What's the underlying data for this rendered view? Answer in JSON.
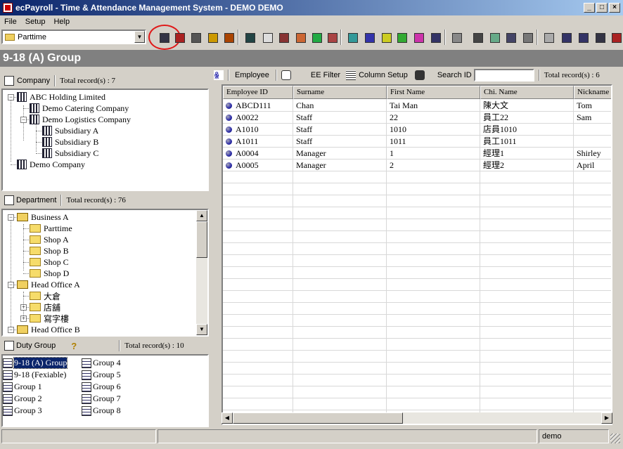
{
  "window": {
    "title": "ecPayroll - Time & Attendance Management System - DEMO DEMO"
  },
  "menu": [
    "File",
    "Setup",
    "Help"
  ],
  "toolbar": {
    "combo_value": "Parttime"
  },
  "group_title": "9-18 (A) Group",
  "company_panel": {
    "label": "Company",
    "total": "Total record(s) : 7",
    "items": [
      "ABC Holding Limited",
      "Demo Catering Company",
      "Demo Logistics Company",
      "Subsidiary A",
      "Subsidiary B",
      "Subsidiary C",
      "Demo Company"
    ]
  },
  "department_panel": {
    "label": "Department",
    "total": "Total record(s) : 76",
    "items": [
      "Business A",
      "Parttime",
      "Shop A",
      "Shop B",
      "Shop C",
      "Shop D",
      "Head Office A",
      "大倉",
      "店舖",
      "寫字樓",
      "Head Office B"
    ]
  },
  "duty_panel": {
    "label": "Duty Group",
    "total": "Total record(s) : 10",
    "col1": [
      "9-18 (A) Group",
      "9-18 (Fexiable)",
      "Group 1",
      "Group 2",
      "Group 3"
    ],
    "col2": [
      "Group 4",
      "Group 5",
      "Group 6",
      "Group 7",
      "Group 8"
    ]
  },
  "employee_toolbar": {
    "employee": "Employee",
    "ee_filter": "EE Filter",
    "column_setup": "Column Setup",
    "search_label": "Search ID",
    "search_value": "",
    "total": "Total record(s) : 6"
  },
  "grid": {
    "columns": [
      "Employee ID",
      "Surname",
      "First Name",
      "Chi. Name",
      "Nickname"
    ],
    "rows": [
      [
        "ABCD111",
        "Chan",
        "Tai Man",
        "陳大文",
        "Tom"
      ],
      [
        "A0022",
        "Staff",
        "22",
        "員工22",
        "Sam"
      ],
      [
        "A1010",
        "Staff",
        "1010",
        "店員1010",
        ""
      ],
      [
        "A1011",
        "Staff",
        "1011",
        "員工1011",
        ""
      ],
      [
        "A0004",
        "Manager",
        "1",
        "經理1",
        "Shirley"
      ],
      [
        "A0005",
        "Manager",
        "2",
        "經理2",
        "April"
      ]
    ]
  },
  "status": {
    "user": "demo"
  }
}
